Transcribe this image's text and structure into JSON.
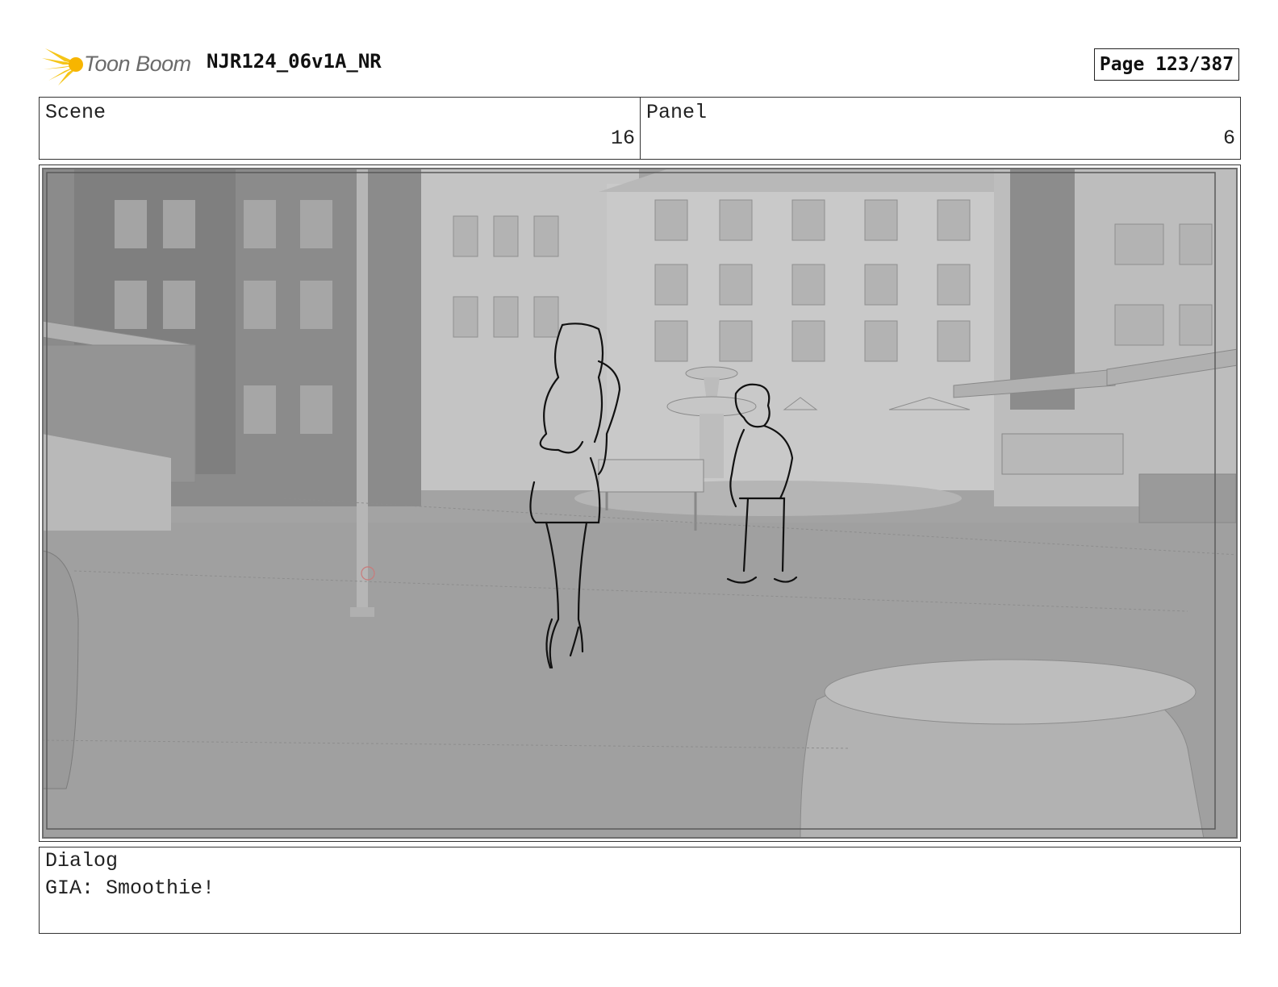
{
  "header": {
    "logo_text": "Toon Boom",
    "document_title": "NJR124_06v1A_NR",
    "page_label": "Page 123/387"
  },
  "info": {
    "scene_label": "Scene",
    "scene_value": "16",
    "panel_label": "Panel",
    "panel_value": "6"
  },
  "dialog": {
    "label": "Dialog",
    "text": "GIA: Smoothie!"
  },
  "colors": {
    "logo_star": "#f5c518",
    "background_gray": "#9c9c9c",
    "line_art": "#111111"
  }
}
